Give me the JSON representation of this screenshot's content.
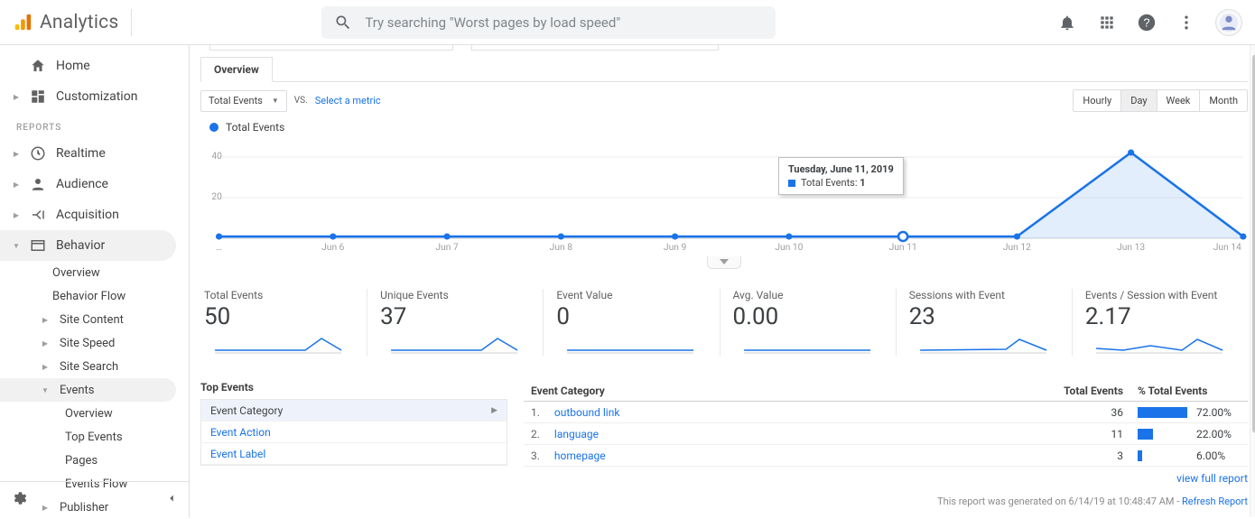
{
  "header": {
    "product": "Analytics",
    "search_placeholder": "Try searching \"Worst pages by load speed\""
  },
  "nav": {
    "home": "Home",
    "customization": "Customization",
    "reports_label": "REPORTS",
    "realtime": "Realtime",
    "audience": "Audience",
    "acquisition": "Acquisition",
    "behavior": "Behavior",
    "behavior_children": {
      "overview": "Overview",
      "flow": "Behavior Flow",
      "site_content": "Site Content",
      "site_speed": "Site Speed",
      "site_search": "Site Search",
      "events": "Events",
      "events_children": {
        "overview": "Overview",
        "top_events": "Top Events",
        "pages": "Pages",
        "events_flow": "Events Flow"
      },
      "publisher": "Publisher"
    }
  },
  "report": {
    "tab": "Overview",
    "primary_metric": "Total Events",
    "vs": "VS.",
    "select_metric": "Select a metric",
    "granularity": [
      "Hourly",
      "Day",
      "Week",
      "Month"
    ],
    "legend": "Total Events",
    "tooltip_title": "Tuesday, June 11, 2019",
    "tooltip_metric": "Total Events: ",
    "tooltip_value": "1"
  },
  "chart_data": {
    "type": "line",
    "series": [
      {
        "name": "Total Events",
        "values": [
          1,
          1,
          1,
          1,
          1,
          1,
          1,
          40,
          1
        ]
      }
    ],
    "x": [
      "…",
      "Jun 6",
      "Jun 7",
      "Jun 8",
      "Jun 9",
      "Jun 10",
      "Jun 11",
      "Jun 12",
      "Jun 13",
      "Jun 14"
    ],
    "y_ticks": [
      20,
      40
    ],
    "ylim": [
      0,
      45
    ],
    "highlight_index": 6,
    "title": "",
    "xlabel": "",
    "ylabel": ""
  },
  "cards": [
    {
      "label": "Total Events",
      "value": "50"
    },
    {
      "label": "Unique Events",
      "value": "37"
    },
    {
      "label": "Event Value",
      "value": "0"
    },
    {
      "label": "Avg. Value",
      "value": "0.00"
    },
    {
      "label": "Sessions with Event",
      "value": "23"
    },
    {
      "label": "Events / Session with Event",
      "value": "2.17"
    }
  ],
  "dimensions": {
    "title": "Top Events",
    "items": [
      "Event Category",
      "Event Action",
      "Event Label"
    ],
    "selected": 0
  },
  "table": {
    "headers": {
      "cat": "Event Category",
      "total": "Total Events",
      "pct": "% Total Events"
    },
    "rows": [
      {
        "idx": "1.",
        "name": "outbound link",
        "total": "36",
        "pct": "72.00%",
        "bar": 72
      },
      {
        "idx": "2.",
        "name": "language",
        "total": "11",
        "pct": "22.00%",
        "bar": 22
      },
      {
        "idx": "3.",
        "name": "homepage",
        "total": "3",
        "pct": "6.00%",
        "bar": 6
      }
    ],
    "view_full": "view full report"
  },
  "footer": {
    "text": "This report was generated on 6/14/19 at 10:48:47 AM - ",
    "refresh": "Refresh Report"
  }
}
